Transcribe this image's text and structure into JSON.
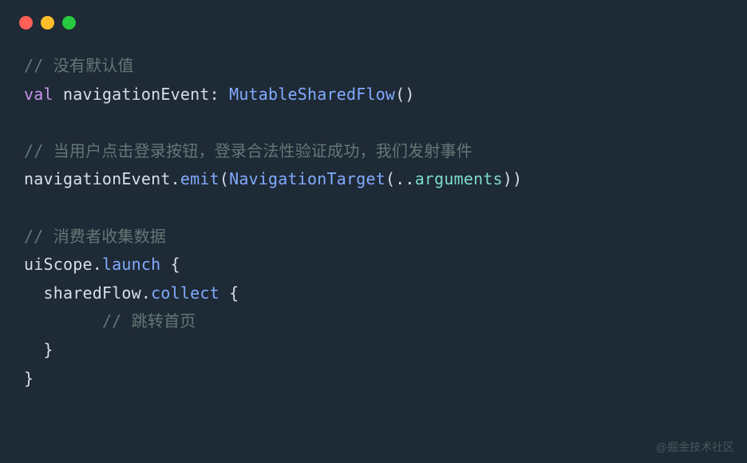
{
  "windowControls": {
    "close": "close",
    "minimize": "minimize",
    "maximize": "maximize"
  },
  "code": {
    "line1_comment": "// 没有默认值",
    "line2_val": "val",
    "line2_name": " navigationEvent",
    "line2_colon": ": ",
    "line2_type": "MutableSharedFlow",
    "line2_parens": "()",
    "line4_comment": "// 当用户点击登录按钮，登录合法性验证成功，我们发射事件",
    "line5_obj": "navigationEvent",
    "line5_dot1": ".",
    "line5_emit": "emit",
    "line5_open": "(",
    "line5_target": "NavigationTarget",
    "line5_open2": "(..",
    "line5_args": "arguments",
    "line5_close": "))",
    "line7_comment": "// 消费者收集数据",
    "line8_scope": "uiScope",
    "line8_dot": ".",
    "line8_launch": "launch",
    "line8_brace": " {",
    "line9_indent": "  ",
    "line9_flow": "sharedFlow",
    "line9_dot": ".",
    "line9_collect": "collect",
    "line9_brace": " {",
    "line10_indent": "        ",
    "line10_comment": "// 跳转首页",
    "line11": "  }",
    "line12": "}"
  },
  "watermark": "@掘金技术社区"
}
